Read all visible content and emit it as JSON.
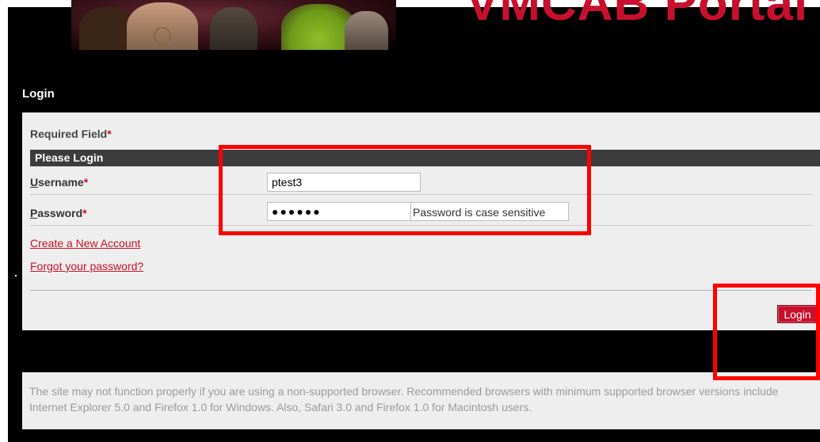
{
  "header": {
    "portal_title": "VMCAB Portal"
  },
  "login": {
    "section_title": "Login",
    "required_label": "Required Field",
    "required_marker": "*",
    "panel_title": "Please Login",
    "username": {
      "label_accel": "U",
      "label_rest": "sername",
      "marker": "*",
      "value": "ptest3"
    },
    "password": {
      "label_accel": "P",
      "label_rest": "assword",
      "marker": "*",
      "value_masked": "●●●●●●",
      "hint": "Password is case sensitive"
    },
    "links": {
      "create_account": "Create a New Account",
      "forgot_password": "Forgot your password?"
    },
    "submit_label": "Login"
  },
  "notice": {
    "text": "The site may not function properly if you are using a non-supported browser. Recommended browsers with minimum supported browser versions include Internet Explorer 5.0 and Firefox 1.0 for Windows. Also, Safari 3.0 and Firefox 1.0 for Macintosh users."
  },
  "colors": {
    "accent": "#c8102e",
    "background": "#000000",
    "panel": "#eeeeee",
    "annotation": "#ff0000"
  }
}
